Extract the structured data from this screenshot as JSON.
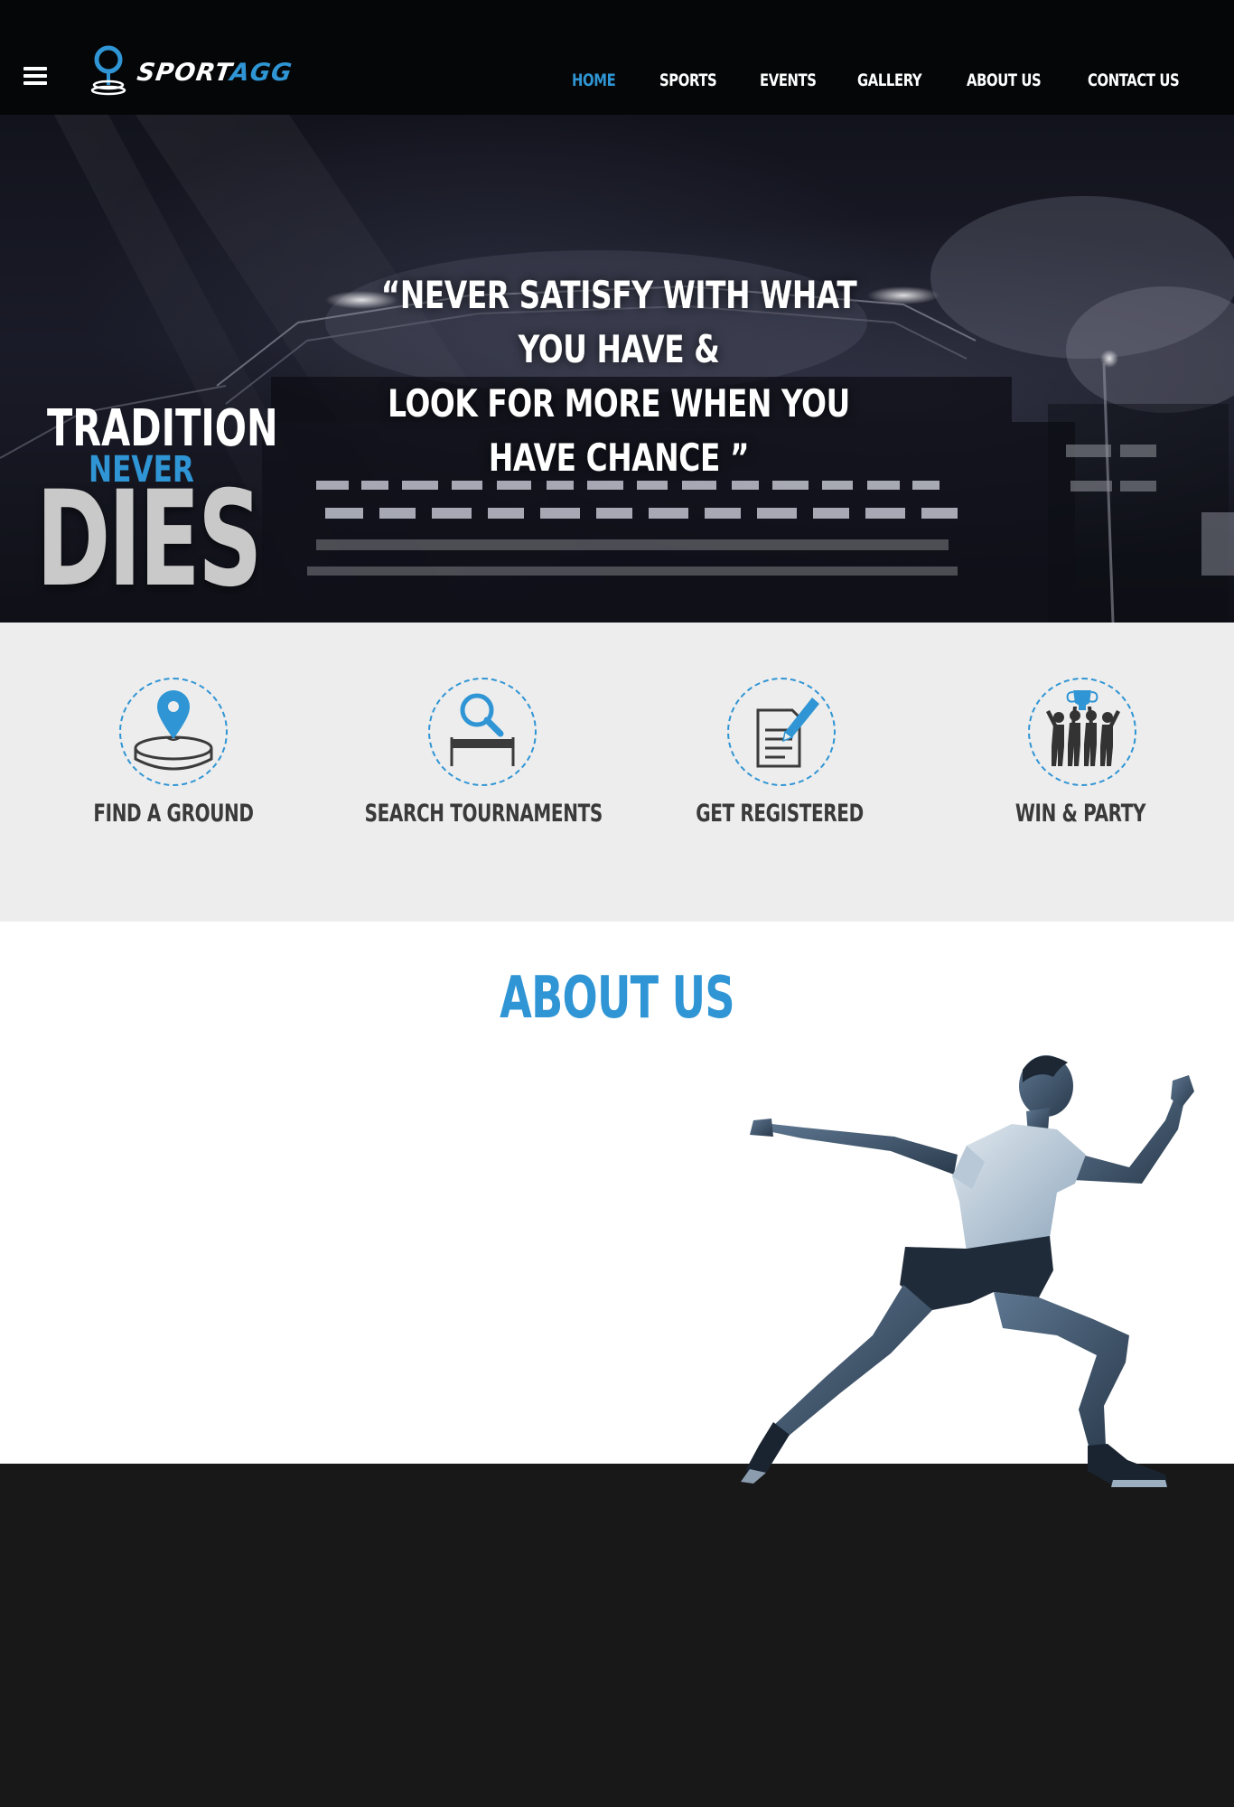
{
  "brand": {
    "name_part1": "SPORT",
    "name_part2": "AGG",
    "accent_color": "#2f95d4"
  },
  "header": {
    "menu_icon": "hamburger-menu-icon",
    "nav": [
      {
        "label": "HOME",
        "active": true
      },
      {
        "label": "SPORTS",
        "active": false
      },
      {
        "label": "EVENTS",
        "active": false
      },
      {
        "label": "GALLERY",
        "active": false
      },
      {
        "label": "ABOUT US",
        "active": false
      },
      {
        "label": "CONTACT US",
        "active": false
      }
    ]
  },
  "hero": {
    "quote_line1": "“NEVER SATISFY WITH WHAT YOU HAVE  &",
    "quote_line2": "LOOK FOR MORE WHEN YOU HAVE CHANCE ”",
    "tagline": {
      "word1": "TRADITION",
      "word2": "NEVER",
      "word3": "DIES"
    }
  },
  "features": [
    {
      "label": "FIND A GROUND",
      "icon": "map-pin-ground-icon"
    },
    {
      "label": "SEARCH TOURNAMENTS",
      "icon": "magnifier-track-icon"
    },
    {
      "label": "GET REGISTERED",
      "icon": "document-pencil-icon"
    },
    {
      "label": "WIN & PARTY",
      "icon": "team-trophy-icon"
    }
  ],
  "about": {
    "title": "ABOUT US"
  }
}
